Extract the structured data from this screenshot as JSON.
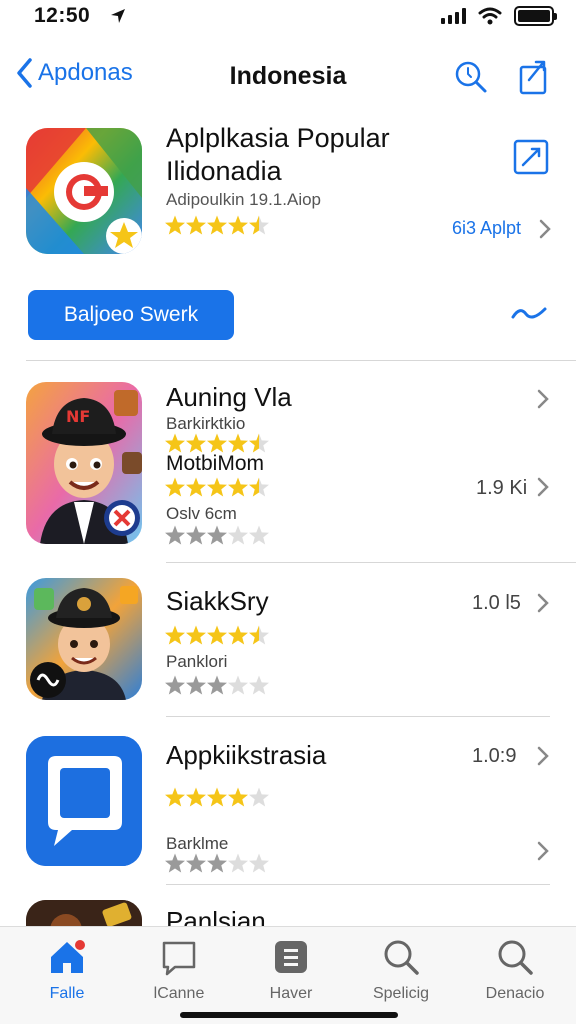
{
  "status": {
    "time": "12:50",
    "battery_level": 1.0
  },
  "nav": {
    "back_label": "Apdonas",
    "title": "Indonesia"
  },
  "featured": {
    "title_line1": "Aplplkasia Popular",
    "title_line2": "Ilidonadia",
    "subtitle": "Adipoulkin 19.1.Aiop",
    "rating": 4.5,
    "count_label": "6i3 Aplpt"
  },
  "action": {
    "button_label": "Baljoeo Swerk"
  },
  "apps": [
    {
      "name": "Auning Vla",
      "line1": "Barkirktkio",
      "line2": "MotbiMom",
      "line3": "Oslv 6cm",
      "meta": "1.9 Ki",
      "rating1": 4.5,
      "rating2": 4.5,
      "rating3": 3
    },
    {
      "name": "SiakkSry",
      "line1": "Panklori",
      "meta": "1.0 l5",
      "rating1": 4.5,
      "rating2": 3
    },
    {
      "name": "Appkiikstrasia",
      "line1": "Barklme",
      "meta": "1.0:9",
      "rating1": 4,
      "rating2": 3
    },
    {
      "name": "Panlsian"
    }
  ],
  "tabs": [
    {
      "label": "Falle",
      "icon": "home-icon",
      "active": true
    },
    {
      "label": "lCanne",
      "icon": "chat-icon",
      "active": false
    },
    {
      "label": "Haver",
      "icon": "document-icon",
      "active": false
    },
    {
      "label": "Spelicig",
      "icon": "search-icon",
      "active": false
    },
    {
      "label": "Denacio",
      "icon": "search-icon",
      "active": false
    }
  ],
  "colors": {
    "accent": "#1a73e8",
    "star": "#f5c518",
    "star_gray": "#9a9a9a"
  }
}
